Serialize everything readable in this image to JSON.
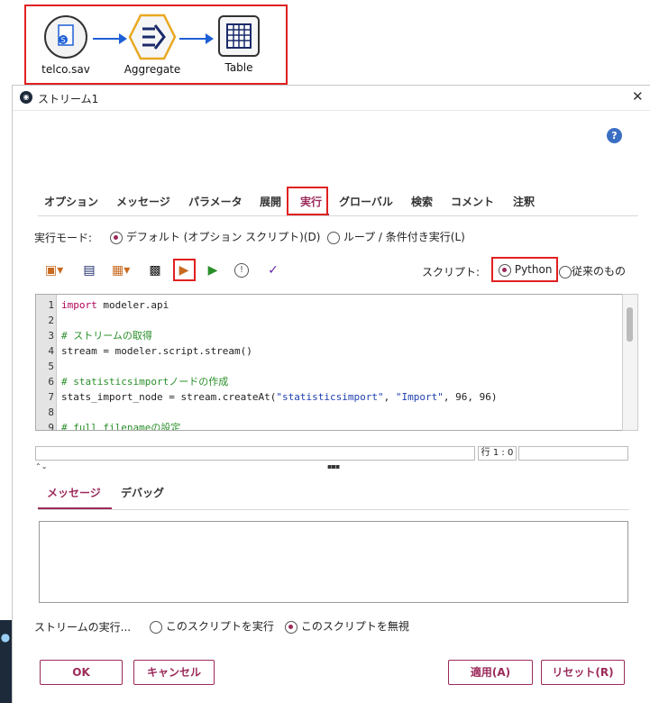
{
  "flow": {
    "nodes": [
      {
        "label": "telco.sav",
        "icon": "spss-file-icon"
      },
      {
        "label": "Aggregate",
        "icon": "aggregate-icon"
      },
      {
        "label": "Table",
        "icon": "table-icon"
      }
    ]
  },
  "dialog": {
    "title": "ストリーム1",
    "help": "?",
    "close": "✕",
    "tabs": [
      "オプション",
      "メッセージ",
      "パラメータ",
      "展開",
      "実行",
      "グローバル",
      "検索",
      "コメント",
      "注釈"
    ],
    "active_tab": "実行",
    "exec_mode_label": "実行モード:",
    "exec_mode_options": [
      "デフォルト (オプション スクリプト)(D)",
      "ループ / 条件付き実行(L)"
    ],
    "exec_mode_selected": 0,
    "script_label": "スクリプト:",
    "script_options": [
      "Python",
      "従来のもの"
    ],
    "script_selected": 0,
    "toolbar_icons": [
      "import-script-icon",
      "save-script-icon",
      "export-script-icon",
      "print-icon",
      "run-script-icon",
      "run-selected-icon",
      "check-syntax-icon",
      "debug-icon"
    ],
    "code_lines": [
      {
        "n": "1",
        "parts": [
          {
            "t": "import",
            "c": "kw"
          },
          {
            "t": " modeler.api",
            "c": ""
          }
        ]
      },
      {
        "n": "2",
        "parts": []
      },
      {
        "n": "3",
        "parts": [
          {
            "t": "# ストリームの取得",
            "c": "cm"
          }
        ]
      },
      {
        "n": "4",
        "parts": [
          {
            "t": "stream = modeler.script.stream()",
            "c": ""
          }
        ]
      },
      {
        "n": "5",
        "parts": []
      },
      {
        "n": "6",
        "parts": [
          {
            "t": "# statisticsimportノードの作成",
            "c": "cm"
          }
        ]
      },
      {
        "n": "7",
        "parts": [
          {
            "t": "stats_import_node = stream.createAt(",
            "c": ""
          },
          {
            "t": "\"statisticsimport\"",
            "c": "str"
          },
          {
            "t": ", ",
            "c": ""
          },
          {
            "t": "\"Import\"",
            "c": "str"
          },
          {
            "t": ", 96, 96)",
            "c": ""
          }
        ]
      },
      {
        "n": "8",
        "parts": []
      },
      {
        "n": "9",
        "parts": [
          {
            "t": "# full filenameの設定",
            "c": "cm"
          }
        ]
      }
    ],
    "status_position": "行 1 : 0",
    "bottom_tabs": [
      "メッセージ",
      "デバッグ"
    ],
    "bottom_active": 0,
    "stream_exec_label": "ストリームの実行...",
    "stream_exec_options": [
      "このスクリプトを実行",
      "このスクリプトを無視"
    ],
    "stream_exec_selected": 1,
    "buttons": {
      "ok": "OK",
      "cancel": "キャンセル",
      "apply": "適用(A)",
      "reset": "リセット(R)"
    }
  }
}
